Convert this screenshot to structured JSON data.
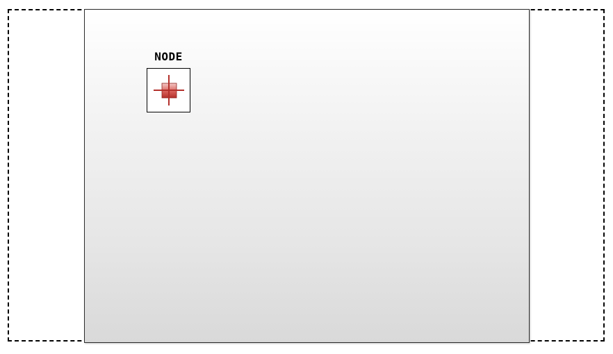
{
  "node": {
    "label": "NODE",
    "icon": "crosshair-node-icon",
    "icon_color": "#b3302b"
  },
  "colors": {
    "outer_border": "#000000",
    "panel_top": "#ffffff",
    "panel_bottom": "#d9d9d9"
  }
}
